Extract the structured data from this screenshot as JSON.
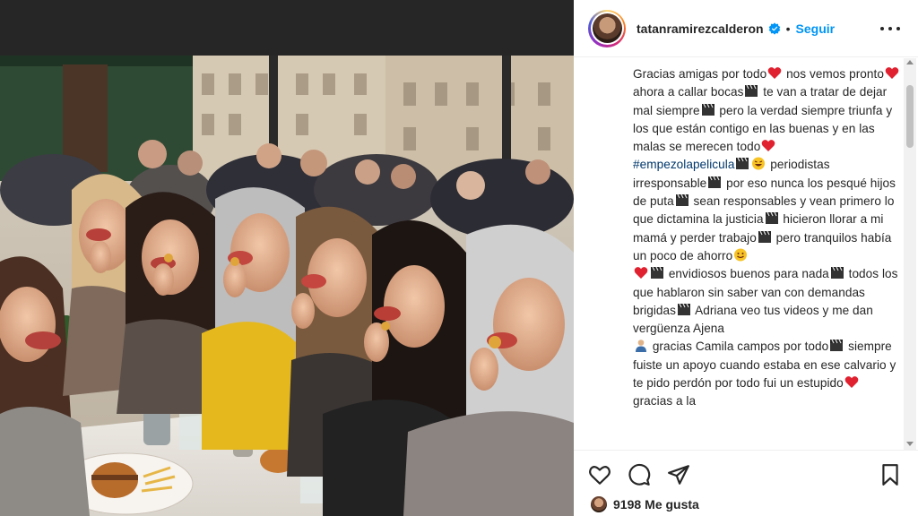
{
  "post": {
    "username": "tatanramirezcalderon",
    "separator": "•",
    "follow_label": "Seguir",
    "verified": true
  },
  "caption": {
    "lines": [
      "Gracias amigas por todo",
      " nos vemos pronto",
      " ahora a callar bocas",
      " te van a tratar de dejar mal siempre",
      " pero la verdad siempre triunfa y los que están contigo en las buenas y en las malas se merecen todo",
      "#empezolapelicula",
      " periodistas irresponsable",
      " por eso nunca los pesqué hijos de puta",
      " sean responsables y vean primero lo que dictamina la justicia",
      " hicieron llorar a mi mamá y perder trabajo",
      " pero tranquilos había un poco de ahorro",
      " envidiosos buenos para nada",
      " todos los que hablaron sin saber van con demandas brigidas",
      " Adriana veo tus videos y me dan vergüenza Ajena",
      " gracias Camila campos por todo",
      " siempre fuiste un apoyo cuando estaba en ese calvario y te pido perdón por todo fui un estupido",
      " gracias a la"
    ]
  },
  "likes": {
    "count": "9198",
    "label": "Me gusta"
  },
  "icons": [
    "verified-badge-icon",
    "more-options-icon",
    "heart-icon",
    "comment-icon",
    "share-icon",
    "bookmark-icon",
    "heart-emoji-icon",
    "clapper-emoji-icon",
    "laughing-emoji-icon",
    "smile-emoji-icon",
    "person-emoji-icon"
  ],
  "colors": {
    "follow": "#0095f6",
    "hashtag": "#00376b",
    "text": "#262626"
  }
}
